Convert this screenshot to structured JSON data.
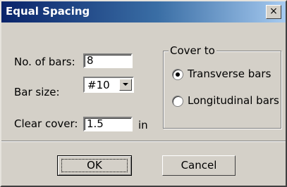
{
  "window": {
    "title": "Equal Spacing",
    "close_glyph": "×"
  },
  "fields": {
    "bars_label": "No. of bars:",
    "bars_value": "8",
    "size_label": "Bar size:",
    "size_value": "#10",
    "cover_label": "Clear cover:",
    "cover_value": "1.5",
    "cover_unit": "in"
  },
  "cover_group": {
    "legend": "Cover to",
    "options": [
      {
        "label": "Transverse bars",
        "selected": true
      },
      {
        "label": "Longitudinal bars",
        "selected": false
      }
    ]
  },
  "buttons": {
    "ok": "OK",
    "cancel": "Cancel"
  }
}
